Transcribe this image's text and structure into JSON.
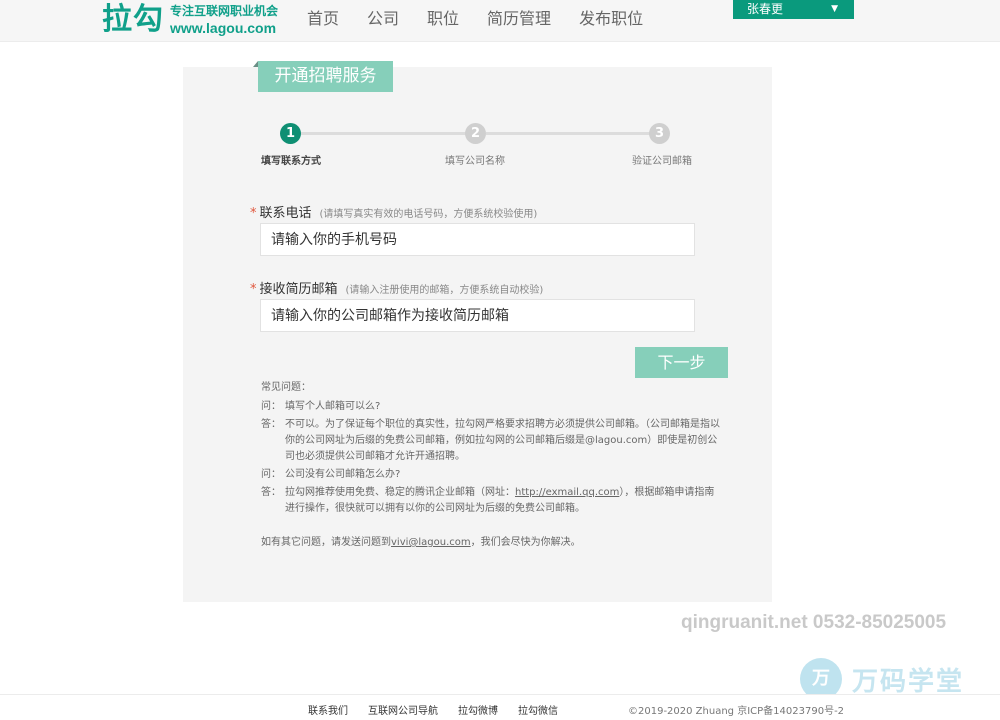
{
  "header": {
    "logo_mark": "拉勾",
    "logo_slogan": "专注互联网职业机会",
    "logo_url": "www.lagou.com",
    "nav": [
      "首页",
      "公司",
      "职位",
      "简历管理",
      "发布职位"
    ],
    "user_name": "张春更"
  },
  "panel": {
    "title": "开通招聘服务",
    "steps": [
      {
        "number": "1",
        "label": "填写联系方式",
        "active": true
      },
      {
        "number": "2",
        "label": "填写公司名称",
        "active": false
      },
      {
        "number": "3",
        "label": "验证公司邮箱",
        "active": false
      }
    ],
    "phone": {
      "label": "联系电话",
      "hint": "(请填写真实有效的电话号码，方便系统校验使用)",
      "placeholder": "请输入你的手机号码"
    },
    "email": {
      "label": "接收简历邮箱",
      "hint": "(请输入注册使用的邮箱，方便系统自动校验)",
      "placeholder": "请输入你的公司邮箱作为接收简历邮箱"
    },
    "next_label": "下一步",
    "required_mark": "*"
  },
  "faq": {
    "title": "常见问题：",
    "q_tag": "问：",
    "a_tag": "答：",
    "q1": "填写个人邮箱可以么?",
    "a1": "不可以。为了保证每个职位的真实性，拉勾网严格要求招聘方必须提供公司邮箱。（公司邮箱是指以你的公司网址为后缀的免费公司邮箱，例如拉勾网的公司邮箱后缀是@lagou.com）即使是初创公司也必须提供公司邮箱才允许开通招聘。",
    "q2": "公司没有公司邮箱怎么办?",
    "a2_before": "拉勾网推荐使用免费、稳定的腾讯企业邮箱（网址：",
    "a2_link": "http://exmail.qq.com",
    "a2_after": "），根据邮箱申请指南进行操作，很快就可以拥有以你的公司网址为后缀的免费公司邮箱。",
    "contact_before": "如有其它问题，请发送问题到",
    "contact_email": "vivi@lagou.com",
    "contact_after": "，我们会尽快为你解决。"
  },
  "watermark": {
    "text": "qingruanit.net 0532-85025005",
    "brand_icon": "万",
    "brand_name": "万码学堂"
  },
  "footer": {
    "links": [
      "联系我们",
      "互联网公司导航",
      "拉勾微博",
      "拉勾微信"
    ],
    "copyright": "©2019-2020 Zhuang    京ICP备14023790号-2"
  },
  "colors": {
    "brand": "#10a08a",
    "accent": "#86cfba",
    "active_step": "#0f8f73"
  }
}
